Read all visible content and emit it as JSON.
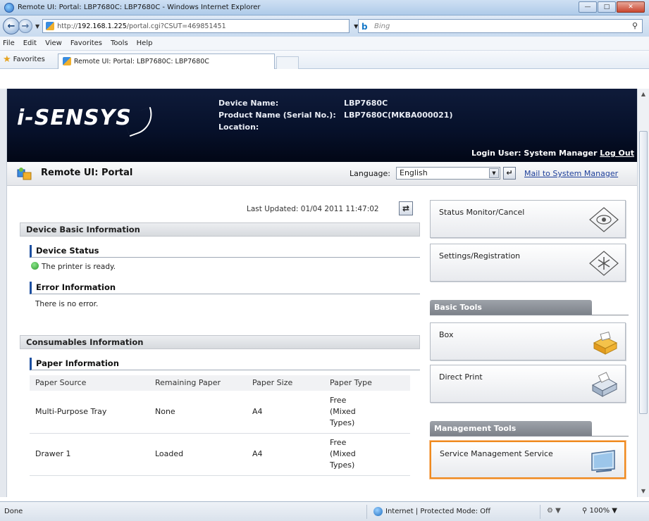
{
  "window": {
    "title": "Remote UI: Portal: LBP7680C: LBP7680C - Windows Internet Explorer",
    "minimize_icon": "minimize-icon",
    "maximize_icon": "maximize-icon",
    "close_icon": "close-icon"
  },
  "address_bar": {
    "url_prefix": "http://",
    "url_host": "192.168.1.225",
    "url_path": "/portal.cgi?CSUT=469851451",
    "search_placeholder": "Bing"
  },
  "menu": [
    "File",
    "Edit",
    "View",
    "Favorites",
    "Tools",
    "Help"
  ],
  "favorites_bar": {
    "favorites_label": "Favorites",
    "tab_title": "Remote UI: Portal: LBP7680C: LBP7680C"
  },
  "banner": {
    "logo": "i-SENSYS",
    "device_name_label": "Device Name:",
    "device_name_value": "LBP7680C",
    "product_name_label": "Product Name (Serial No.):",
    "product_name_value": "LBP7680C(MKBA000021)",
    "location_label": "Location:",
    "login_user_text": "Login User: System Manager",
    "logout_label": "Log Out"
  },
  "portal_bar": {
    "title": "Remote UI: Portal",
    "language_label": "Language:",
    "language_value": "English",
    "mail_link": "Mail to System Manager"
  },
  "main": {
    "last_updated": "Last Updated: 01/04 2011 11:47:02",
    "device_basic_info": "Device Basic Information",
    "device_status": "Device Status",
    "status_text": "The printer is ready.",
    "error_info": "Error Information",
    "error_text": "There is no error.",
    "consumables_info": "Consumables Information",
    "paper_info": "Paper Information",
    "paper_table": {
      "headers": [
        "Paper Source",
        "Remaining Paper",
        "Paper Size",
        "Paper Type"
      ],
      "rows": [
        [
          "Multi-Purpose Tray",
          "None",
          "A4",
          "Free\n(Mixed\nTypes)"
        ],
        [
          "Drawer 1",
          "Loaded",
          "A4",
          "Free\n(Mixed\nTypes)"
        ]
      ]
    }
  },
  "right_panel": {
    "status_monitor": "Status Monitor/Cancel",
    "settings": "Settings/Registration",
    "basic_tools": "Basic Tools",
    "box": "Box",
    "direct_print": "Direct Print",
    "management_tools": "Management Tools",
    "service_mgmt": "Service Management Service"
  },
  "status_bar": {
    "status": "Done",
    "zone": "Internet | Protected Mode: Off",
    "zoom": "100%"
  },
  "colors": {
    "banner_bg": "#061029",
    "highlight_border": "#ef8a1f",
    "section_header": "#1c4fa0",
    "link": "#1e3f9a"
  }
}
